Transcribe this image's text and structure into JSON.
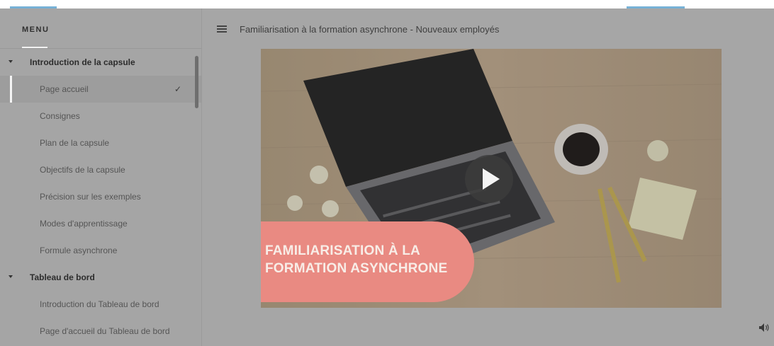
{
  "menu": {
    "title": "MENU",
    "sections": [
      {
        "label": "Introduction de la capsule",
        "items": [
          {
            "label": "Page accueil",
            "active": true,
            "completed": true
          },
          {
            "label": "Consignes"
          },
          {
            "label": "Plan de la capsule"
          },
          {
            "label": "Objectifs de la capsule"
          },
          {
            "label": "Précision sur les exemples"
          },
          {
            "label": "Modes d'apprentissage"
          },
          {
            "label": "Formule asynchrone"
          }
        ]
      },
      {
        "label": "Tableau de bord",
        "items": [
          {
            "label": "Introduction du Tableau de bord"
          },
          {
            "label": "Page d'accueil du Tableau de bord"
          }
        ]
      }
    ]
  },
  "header": {
    "course_title": "Familiarisation à la formation asynchrone - Nouveaux employés"
  },
  "video": {
    "banner_line1": "FAMILIARISATION À LA",
    "banner_line2": "FORMATION ASYNCHRONE"
  },
  "icons": {
    "menu": "hamburger-icon",
    "caret": "caret-down-icon",
    "check": "check-icon",
    "play": "play-icon",
    "volume": "volume-icon"
  },
  "colors": {
    "banner": "#e98a82",
    "accent": "#77b1d6",
    "overlay": "#a6a6a6"
  }
}
